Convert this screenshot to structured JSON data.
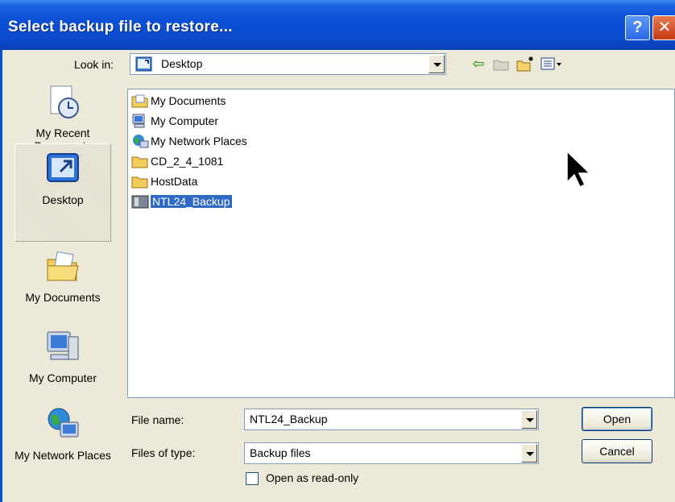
{
  "window": {
    "title": "Select backup file to restore..."
  },
  "titlebar_buttons": {
    "help": "?",
    "close": "✕"
  },
  "look_in": {
    "label": "Look in:",
    "value": "Desktop"
  },
  "places": [
    {
      "id": "recent",
      "label": "My Recent Documents",
      "icon": "recent-documents-icon"
    },
    {
      "id": "desktop",
      "label": "Desktop",
      "icon": "desktop-icon",
      "selected": true
    },
    {
      "id": "mydocs",
      "label": "My Documents",
      "icon": "my-documents-icon"
    },
    {
      "id": "mycomputer",
      "label": "My Computer",
      "icon": "my-computer-icon"
    },
    {
      "id": "network",
      "label": "My Network Places",
      "icon": "network-places-icon"
    }
  ],
  "files": [
    {
      "name": "My Documents",
      "icon": "my-documents-icon"
    },
    {
      "name": "My Computer",
      "icon": "my-computer-icon"
    },
    {
      "name": "My Network Places",
      "icon": "network-places-icon"
    },
    {
      "name": "CD_2_4_1081",
      "icon": "folder-icon"
    },
    {
      "name": "HostData",
      "icon": "folder-icon"
    },
    {
      "name": "NTL24_Backup",
      "icon": "backup-file-icon",
      "selected": true
    }
  ],
  "file_name": {
    "label": "File name:",
    "value": "NTL24_Backup"
  },
  "file_type": {
    "label": "Files of type:",
    "value": "Backup files"
  },
  "read_only": {
    "label": "Open as read-only",
    "checked": false
  },
  "buttons": {
    "open": "Open",
    "cancel": "Cancel"
  },
  "colors": {
    "titlebar": "#0a4fd6",
    "selection": "#316ac5",
    "face": "#ece9d8"
  }
}
